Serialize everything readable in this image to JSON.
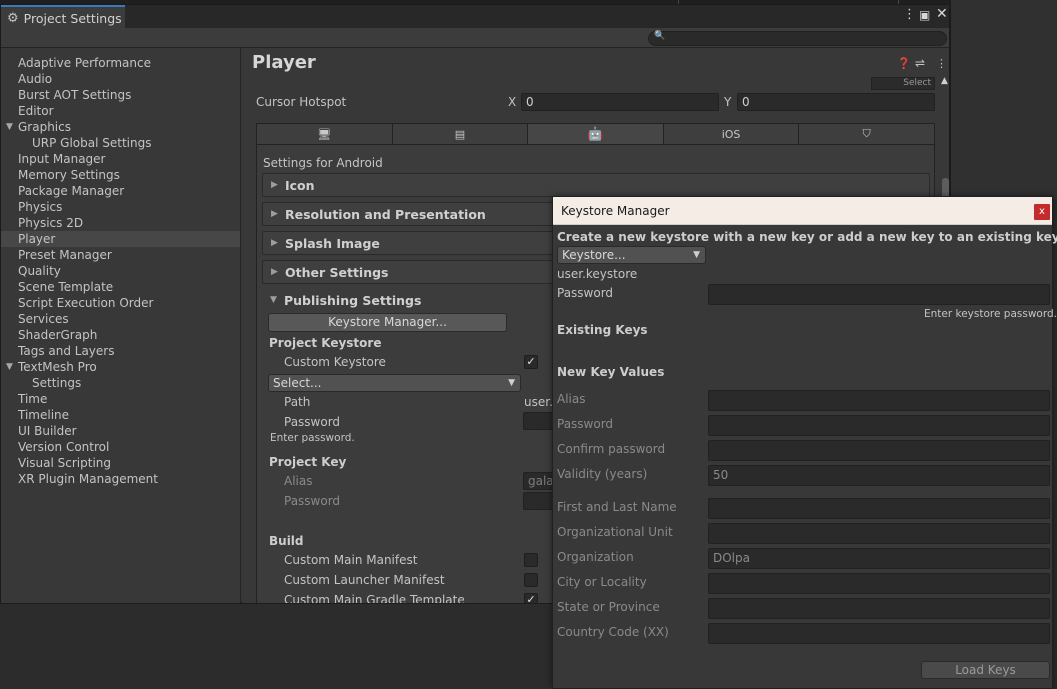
{
  "window": {
    "title": "Project Settings",
    "menu_icon": "kebab-menu-icon",
    "maximize_icon": "maximize-icon",
    "close_icon": "close-icon",
    "search_placeholder": ""
  },
  "sidebar": {
    "items": [
      {
        "label": "Adaptive Performance",
        "indent": 0
      },
      {
        "label": "Audio",
        "indent": 0
      },
      {
        "label": "Burst AOT Settings",
        "indent": 0
      },
      {
        "label": "Editor",
        "indent": 0
      },
      {
        "label": "Graphics",
        "indent": 0,
        "foldout": true
      },
      {
        "label": "URP Global Settings",
        "indent": 1
      },
      {
        "label": "Input Manager",
        "indent": 0
      },
      {
        "label": "Memory Settings",
        "indent": 0
      },
      {
        "label": "Package Manager",
        "indent": 0
      },
      {
        "label": "Physics",
        "indent": 0
      },
      {
        "label": "Physics 2D",
        "indent": 0
      },
      {
        "label": "Player",
        "indent": 0,
        "active": true
      },
      {
        "label": "Preset Manager",
        "indent": 0
      },
      {
        "label": "Quality",
        "indent": 0
      },
      {
        "label": "Scene Template",
        "indent": 0
      },
      {
        "label": "Script Execution Order",
        "indent": 0
      },
      {
        "label": "Services",
        "indent": 0
      },
      {
        "label": "ShaderGraph",
        "indent": 0
      },
      {
        "label": "Tags and Layers",
        "indent": 0
      },
      {
        "label": "TextMesh Pro",
        "indent": 0,
        "foldout": true
      },
      {
        "label": "Settings",
        "indent": 1
      },
      {
        "label": "Time",
        "indent": 0
      },
      {
        "label": "Timeline",
        "indent": 0
      },
      {
        "label": "UI Builder",
        "indent": 0
      },
      {
        "label": "Version Control",
        "indent": 0
      },
      {
        "label": "Visual Scripting",
        "indent": 0
      },
      {
        "label": "XR Plugin Management",
        "indent": 0
      }
    ]
  },
  "player": {
    "title": "Player",
    "select_label": "Select",
    "cursor_hotspot": {
      "label": "Cursor Hotspot",
      "x_label": "X",
      "x_value": "0",
      "y_label": "Y",
      "y_value": "0"
    },
    "platform_tabs": [
      {
        "icon": "monitor-icon",
        "label": ""
      },
      {
        "icon": "server-icon",
        "label": ""
      },
      {
        "icon": "android-icon",
        "label": "",
        "selected": true
      },
      {
        "icon": "",
        "label": "iOS"
      },
      {
        "icon": "html5-icon",
        "label": ""
      }
    ],
    "settings_for": "Settings for Android",
    "sections": {
      "icon": "Icon",
      "resolution": "Resolution and Presentation",
      "splash": "Splash Image",
      "other": "Other Settings",
      "publishing": "Publishing Settings"
    },
    "keystore_manager_button": "Keystore Manager...",
    "project_keystore": {
      "heading": "Project Keystore",
      "custom_keystore_label": "Custom Keystore",
      "custom_keystore_checked": true,
      "select_dropdown": "Select...",
      "path_label": "Path",
      "path_value": "user.k",
      "password_label": "Password",
      "password_hint": "Enter password."
    },
    "project_key": {
      "heading": "Project Key",
      "alias_label": "Alias",
      "alias_value": "gala",
      "password_label": "Password"
    },
    "build": {
      "heading": "Build",
      "items": [
        {
          "label": "Custom Main Manifest",
          "checked": false
        },
        {
          "label": "Custom Launcher Manifest",
          "checked": false
        },
        {
          "label": "Custom Main Gradle Template",
          "checked": true
        }
      ]
    }
  },
  "keystore_manager": {
    "title": "Keystore Manager",
    "close_label": "x",
    "description": "Create a new keystore with a new key or add a new key to an existing keystore",
    "keystore_dropdown": "Keystore...",
    "keystore_file": "user.keystore",
    "password_label": "Password",
    "password_hint": "Enter keystore password.",
    "existing_keys_heading": "Existing Keys",
    "new_key_heading": "New Key Values",
    "fields": [
      {
        "label": "Alias",
        "value": ""
      },
      {
        "label": "Password",
        "value": ""
      },
      {
        "label": "Confirm password",
        "value": ""
      },
      {
        "label": "Validity (years)",
        "value": "50"
      },
      {
        "label": "First and Last Name",
        "value": ""
      },
      {
        "label": "Organizational Unit",
        "value": ""
      },
      {
        "label": "Organization",
        "value": "DOlpa"
      },
      {
        "label": "City or Locality",
        "value": ""
      },
      {
        "label": "State or Province",
        "value": ""
      },
      {
        "label": "Country Code (XX)",
        "value": ""
      }
    ],
    "load_keys_button": "Load Keys"
  }
}
